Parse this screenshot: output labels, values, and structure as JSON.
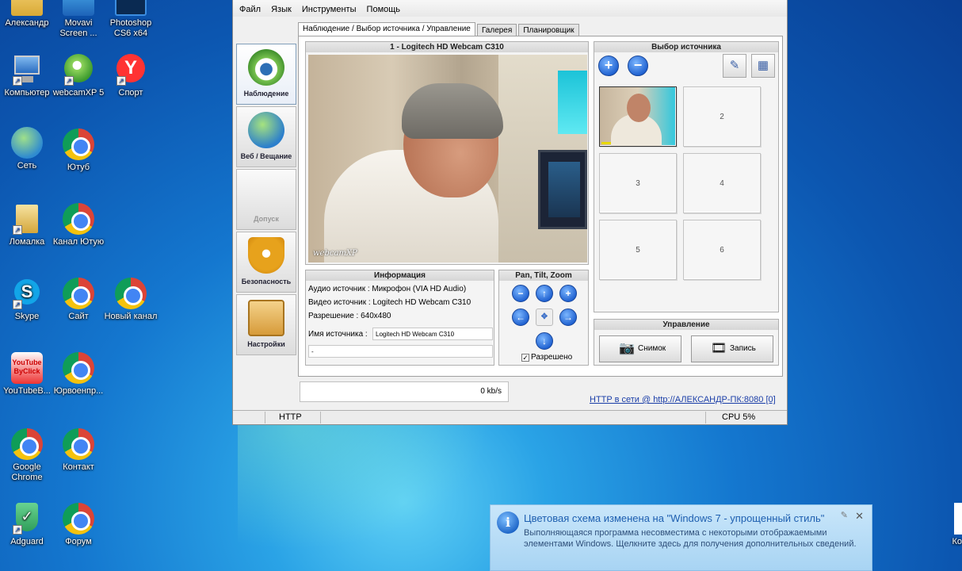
{
  "desktop": {
    "icons": [
      {
        "label": "Александр"
      },
      {
        "label": "Movavi Screen ..."
      },
      {
        "label": "Photoshop CS6 x64"
      },
      {
        "label": "Компьютер"
      },
      {
        "label": "webcamXP 5"
      },
      {
        "label": "Спорт"
      },
      {
        "label": "Сеть"
      },
      {
        "label": "Ютуб"
      },
      {
        "label": "Ломалка"
      },
      {
        "label": "Канал Ютую"
      },
      {
        "label": "Skype"
      },
      {
        "label": "Сайт"
      },
      {
        "label": "Новый канал"
      },
      {
        "label": "YouTubeB..."
      },
      {
        "label": "Юрвоенпр..."
      },
      {
        "label": "Google Chrome"
      },
      {
        "label": "Контакт"
      },
      {
        "label": "Adguard"
      },
      {
        "label": "Форум"
      },
      {
        "label": "Ко"
      }
    ],
    "youtube_icon_text": "YouTube ByClick"
  },
  "app": {
    "menu": [
      "Файл",
      "Язык",
      "Инструменты",
      "Помощь"
    ],
    "tabs": [
      "Наблюдение / Выбор источника / Управление",
      "Галерея",
      "Планировщик"
    ],
    "nav": [
      {
        "label": "Наблюдение"
      },
      {
        "label": "Веб / Вещание"
      },
      {
        "label": "Допуск"
      },
      {
        "label": "Безопасность"
      },
      {
        "label": "Настройки"
      }
    ],
    "video": {
      "title": "1 - Logitech HD Webcam C310",
      "watermark": "webcamXP"
    },
    "info": {
      "title": "Информация",
      "audio": "Аудио источник : Микрофон (VIA HD Audio)",
      "video": "Видео источник : Logitech HD Webcam C310",
      "resolution": "Разрешение : 640x480",
      "name_label": "Имя источника :",
      "name_value": "Logitech HD Webcam C310",
      "extra_value": "-"
    },
    "ptz": {
      "title": "Pan, Tilt, Zoom",
      "allowed_label": "Разрешено",
      "allowed": true
    },
    "source": {
      "title": "Выбор источника",
      "slots": [
        "",
        "2",
        "3",
        "4",
        "5",
        "6"
      ]
    },
    "control": {
      "title": "Управление",
      "snapshot_label": "Снимок",
      "record_label": "Запись"
    },
    "rate": "0 kb/s",
    "http_link": "HTTP в сети @ http://АЛЕКСАНДР-ПК:8080 [0]",
    "status": {
      "left": "HTTP",
      "cpu": "CPU 5%"
    }
  },
  "notification": {
    "title": "Цветовая схема изменена на \"Windows 7 - упрощенный стиль\"",
    "body": "Выполняющаяся программа несовместима с некоторыми отображаемыми элементами Windows. Щелкните здесь для получения дополнительных сведений."
  },
  "colors": {
    "desktop_blue": "#1477cf",
    "link_blue": "#1a3ea8",
    "notify_bg": "#b8dcf6"
  }
}
